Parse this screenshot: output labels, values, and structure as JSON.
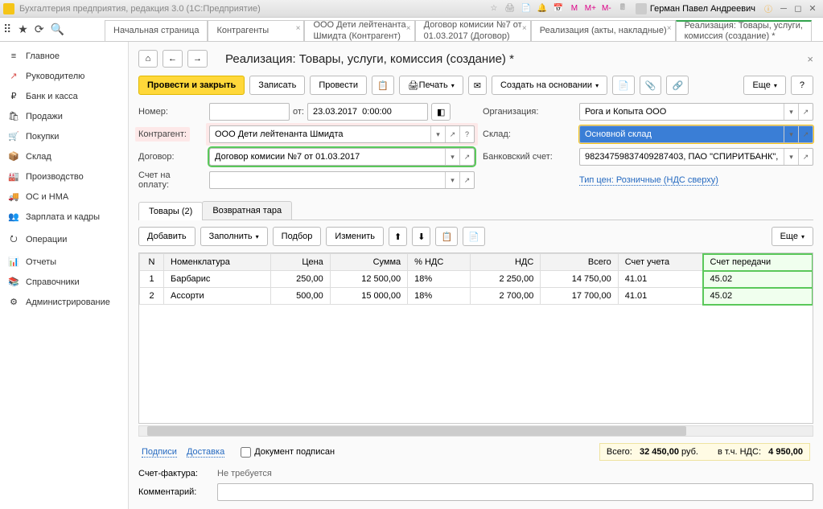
{
  "titlebar": {
    "title": "Бухгалтерия предприятия, редакция 3.0  (1С:Предприятие)",
    "user": "Герман Павел Андреевич"
  },
  "tabs": [
    {
      "l1": "Начальная страница",
      "l2": ""
    },
    {
      "l1": "Контрагенты",
      "l2": ""
    },
    {
      "l1": "ООО Дети лейтенанта",
      "l2": "Шмидта (Контрагент)"
    },
    {
      "l1": "Договор комисии №7 от",
      "l2": "01.03.2017 (Договор)"
    },
    {
      "l1": "Реализация (акты, накладные)",
      "l2": ""
    },
    {
      "l1": "Реализация: Товары, услуги,",
      "l2": "комиссия (создание) *"
    }
  ],
  "sidebar": [
    {
      "icon": "≡",
      "label": "Главное",
      "color": "#555"
    },
    {
      "icon": "↗",
      "label": "Руководителю",
      "color": "#d9534f"
    },
    {
      "icon": "₽",
      "label": "Банк и касса",
      "color": "#555"
    },
    {
      "icon": "🛍",
      "label": "Продажи",
      "color": "#555"
    },
    {
      "icon": "🛒",
      "label": "Покупки",
      "color": "#555"
    },
    {
      "icon": "📦",
      "label": "Склад",
      "color": "#555"
    },
    {
      "icon": "🏭",
      "label": "Производство",
      "color": "#555"
    },
    {
      "icon": "🚚",
      "label": "ОС и НМА",
      "color": "#555"
    },
    {
      "icon": "👥",
      "label": "Зарплата и кадры",
      "color": "#555"
    },
    {
      "icon": "⭮",
      "label": "Операции",
      "color": "#555"
    },
    {
      "icon": "📊",
      "label": "Отчеты",
      "color": "#555"
    },
    {
      "icon": "📚",
      "label": "Справочники",
      "color": "#555"
    },
    {
      "icon": "⚙",
      "label": "Администрирование",
      "color": "#555"
    }
  ],
  "page": {
    "back": "←",
    "fwd": "→",
    "title": "Реализация: Товары, услуги, комиссия (создание) *"
  },
  "buttons": {
    "post_close": "Провести и закрыть",
    "write": "Записать",
    "post": "Провести",
    "print": "Печать",
    "create_based": "Создать на основании",
    "more": "Еще",
    "help": "?"
  },
  "form": {
    "nomer_lbl": "Номер:",
    "nomer_val": "",
    "date_lbl": "от:",
    "date_val": "23.03.2017  0:00:00",
    "org_lbl": "Организация:",
    "org_val": "Рога и Копыта ООО",
    "contr_lbl": "Контрагент:",
    "contr_val": "ООО Дети лейтенанта Шмидта",
    "sklad_lbl": "Склад:",
    "sklad_val": "Основной склад",
    "dog_lbl": "Договор:",
    "dog_val": "Договор комисии №7 от 01.03.2017",
    "bank_lbl": "Банковский счет:",
    "bank_val": "98234759837409287403, ПАО \"СПИРИТБАНК\",",
    "schet_lbl": "Счет на оплату:",
    "schet_val": "",
    "price_type_link": "Тип цен: Розничные (НДС сверху)"
  },
  "innertabs": {
    "t1": "Товары (2)",
    "t2": "Возвратная тара"
  },
  "tbltools": {
    "add": "Добавить",
    "fill": "Заполнить",
    "pick": "Подбор",
    "change": "Изменить",
    "more": "Еще"
  },
  "cols": [
    "N",
    "Номенклатура",
    "Цена",
    "Сумма",
    "% НДС",
    "НДС",
    "Всего",
    "Счет учета",
    "Счет передачи"
  ],
  "rows": [
    {
      "n": "1",
      "name": "Барбарис",
      "price": "250,00",
      "sum": "12 500,00",
      "nds_p": "18%",
      "nds": "2 250,00",
      "total": "14 750,00",
      "acc": "41.01",
      "acc2": "45.02"
    },
    {
      "n": "2",
      "name": "Ассорти",
      "price": "500,00",
      "sum": "15 000,00",
      "nds_p": "18%",
      "nds": "2 700,00",
      "total": "17 700,00",
      "acc": "41.01",
      "acc2": "45.02"
    }
  ],
  "totals": {
    "sign": "Подписи",
    "delivery": "Доставка",
    "doc_signed": "Документ подписан",
    "total_lbl": "Всего:",
    "total_val": "32 450,00",
    "currency": "руб.",
    "nds_lbl": "в т.ч. НДС:",
    "nds_val": "4 950,00"
  },
  "footer": {
    "sf_lbl": "Счет-фактура:",
    "sf_val": "Не требуется",
    "comm_lbl": "Комментарий:",
    "comm_val": ""
  }
}
